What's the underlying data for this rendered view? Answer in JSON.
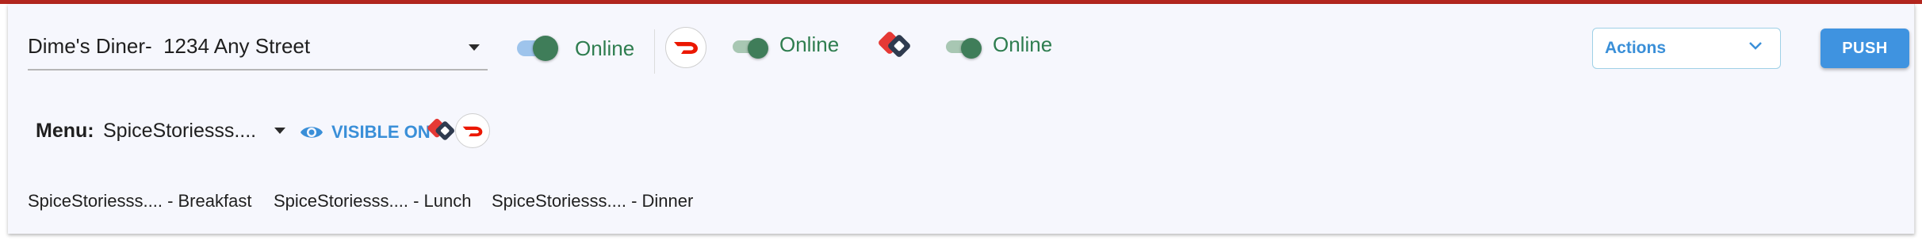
{
  "store": {
    "name": "Dime's Diner-  1234 Any Street"
  },
  "platforms": [
    {
      "name": "primary",
      "status": "Online",
      "enabled": true,
      "color": "#9ec4ec"
    },
    {
      "name": "doordash",
      "status": "Online",
      "enabled": true,
      "logo_icon": "doordash-logo-icon",
      "color": "#eb1700"
    },
    {
      "name": "grubhub-style",
      "status": "Online",
      "enabled": true,
      "logo_icon": "stacked-diamond-logo-icon",
      "color": "#e53935"
    }
  ],
  "toolbar": {
    "actions_label": "Actions",
    "push_label": "PUSH"
  },
  "menu": {
    "label": "Menu:",
    "selected": "SpiceStoriesss....",
    "visible_on_label": "VISIBLE ON",
    "visible_on_platforms": [
      "stacked-diamond-logo-icon",
      "doordash-logo-icon"
    ]
  },
  "dayparts": [
    "SpiceStoriesss.... - Breakfast",
    "SpiceStoriesss.... - Lunch",
    "SpiceStoriesss.... - Dinner"
  ],
  "colors": {
    "accent_blue": "#3a8fd8",
    "online_green": "#2e7d4f",
    "top_bar_red": "#b3261e"
  }
}
